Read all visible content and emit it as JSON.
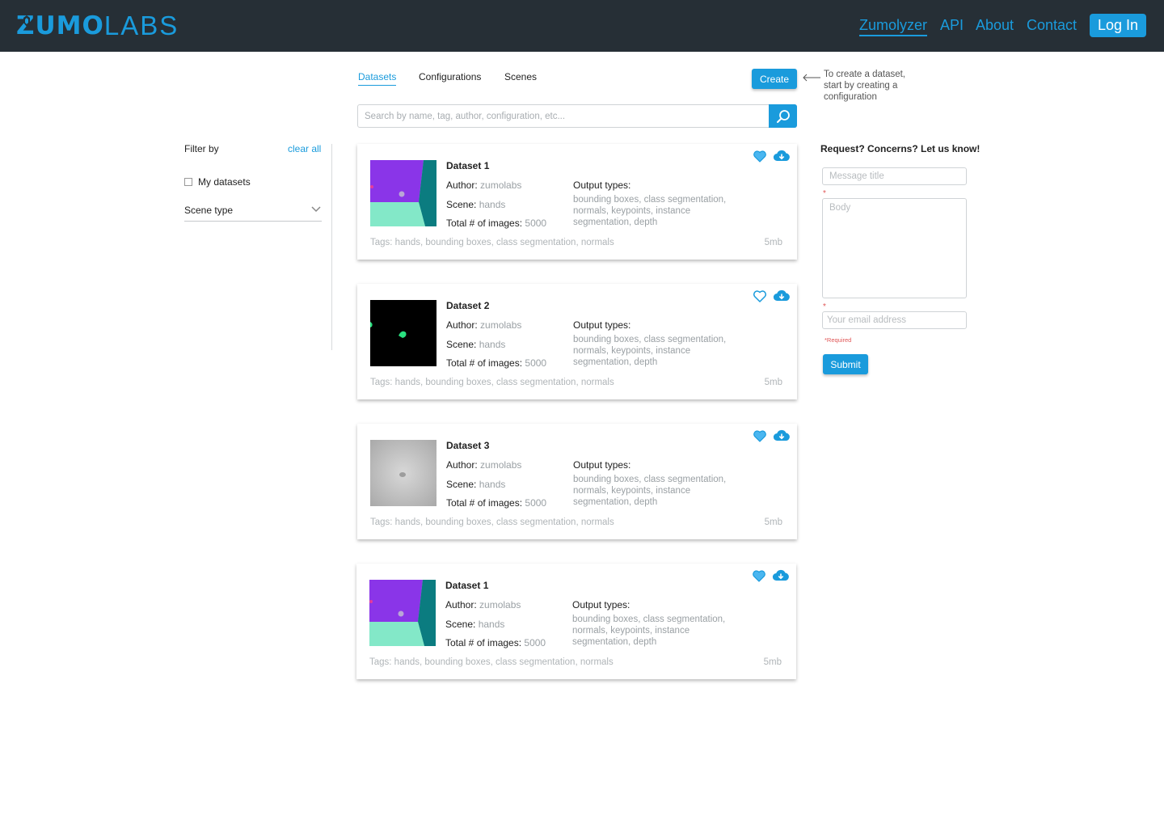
{
  "header": {
    "logo_strong": "ZUMO",
    "logo_light": "LABS",
    "nav": [
      {
        "label": "Zumolyzer",
        "active": true
      },
      {
        "label": "API"
      },
      {
        "label": "About"
      },
      {
        "label": "Contact"
      }
    ],
    "login_label": "Log In"
  },
  "tabs": [
    {
      "label": "Datasets",
      "active": true
    },
    {
      "label": "Configurations"
    },
    {
      "label": "Scenes"
    }
  ],
  "create": {
    "button_label": "Create",
    "hint": "To create a dataset, start by creating a configuration"
  },
  "search": {
    "placeholder": "Search by name, tag, author, configuration, etc..."
  },
  "filter": {
    "title": "Filter by",
    "clear_label": "clear all",
    "my_datasets_label": "My datasets",
    "scene_type_label": "Scene type"
  },
  "labels": {
    "author": "Author",
    "scene": "Scene",
    "total_images": "Total # of images",
    "output_types": "Output types:"
  },
  "datasets": [
    {
      "name": "Dataset 1",
      "author": "zumolabs",
      "scene": "hands",
      "total_images": "5000",
      "output_types": "bounding boxes, class segmentation, normals, keypoints, instance segmentation, depth",
      "tags": "Tags: hands, bounding boxes, class segmentation, normals",
      "size": "5mb",
      "thumb": "segmentation"
    },
    {
      "name": "Dataset 2",
      "author": "zumolabs",
      "scene": "hands",
      "total_images": "5000",
      "output_types": "bounding boxes, class segmentation, normals, keypoints, instance segmentation, depth",
      "tags": "Tags: hands, bounding boxes, class segmentation, normals",
      "size": "5mb",
      "thumb": "mask"
    },
    {
      "name": "Dataset 3",
      "author": "zumolabs",
      "scene": "hands",
      "total_images": "5000",
      "output_types": "bounding boxes, class segmentation, normals, keypoints, instance segmentation, depth",
      "tags": "Tags: hands, bounding boxes, class segmentation, normals",
      "size": "5mb",
      "thumb": "depth"
    },
    {
      "name": "Dataset 1",
      "author": "zumolabs",
      "scene": "hands",
      "total_images": "5000",
      "output_types": "bounding boxes, class segmentation, normals, keypoints, instance segmentation, depth",
      "tags": "Tags: hands, bounding boxes, class segmentation, normals",
      "size": "5mb",
      "thumb": "segmentation"
    }
  ],
  "feedback": {
    "title": "Request? Concerns? Let us know!",
    "message_title_placeholder": "Message title",
    "body_placeholder": "Body",
    "email_placeholder": "Your email address",
    "required_text": "*Required",
    "required_marker": "*",
    "submit_label": "Submit"
  },
  "colors": {
    "accent": "#1a9bdc",
    "topbar": "#262f36",
    "heart": "#4ab6f0"
  }
}
